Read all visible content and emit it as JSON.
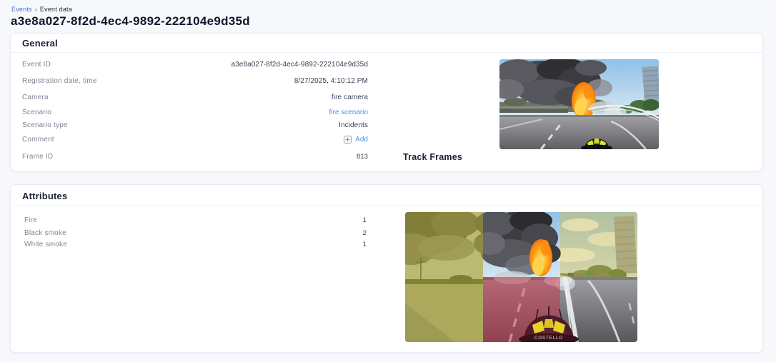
{
  "breadcrumb": {
    "root": "Events",
    "separator": "›",
    "current": "Event data"
  },
  "page_title": "a3e8a027-8f2d-4ec4-9892-222104e9d35d",
  "general": {
    "title": "General",
    "fields": [
      {
        "label": "Event ID",
        "value": "a3e8a027-8f2d-4ec4-9892-222104e9d35d"
      },
      {
        "label": "Registration date, time",
        "value": "8/27/2025, 4:10:12 PM"
      },
      {
        "label": "Camera",
        "value": "fire camera"
      },
      {
        "label": "Scenario",
        "value": "fire scenario"
      },
      {
        "label": "Scenario type",
        "value": "Incidents"
      },
      {
        "label": "Comment",
        "value": "Add"
      },
      {
        "label": "Frame ID",
        "value": "813"
      }
    ],
    "track_frames_title": "Track Frames",
    "image_description": "fire camera frame: highway fire with black smoke, flames, water jet and firefighter helmet"
  },
  "attributes": {
    "title": "Attributes",
    "rows": [
      {
        "label": "Fire",
        "value": "1"
      },
      {
        "label": "Black smoke",
        "value": "2"
      },
      {
        "label": "White smoke",
        "value": "1"
      }
    ],
    "image_description": "composite of track frames with colored attribute overlays (yellow, red)"
  },
  "colors": {
    "breadcrumb_link": "#3d6be0",
    "action_link": "#4f90f2",
    "heading": "#1a2137",
    "label_gray": "#7e8694",
    "value_dark": "#3a4254",
    "page_bg": "#f7f8fc",
    "card_border": "#e8ebf1",
    "overlay_yellow": "rgba(176,170,36,0.50)",
    "overlay_red": "rgba(205,45,70,0.48)"
  }
}
